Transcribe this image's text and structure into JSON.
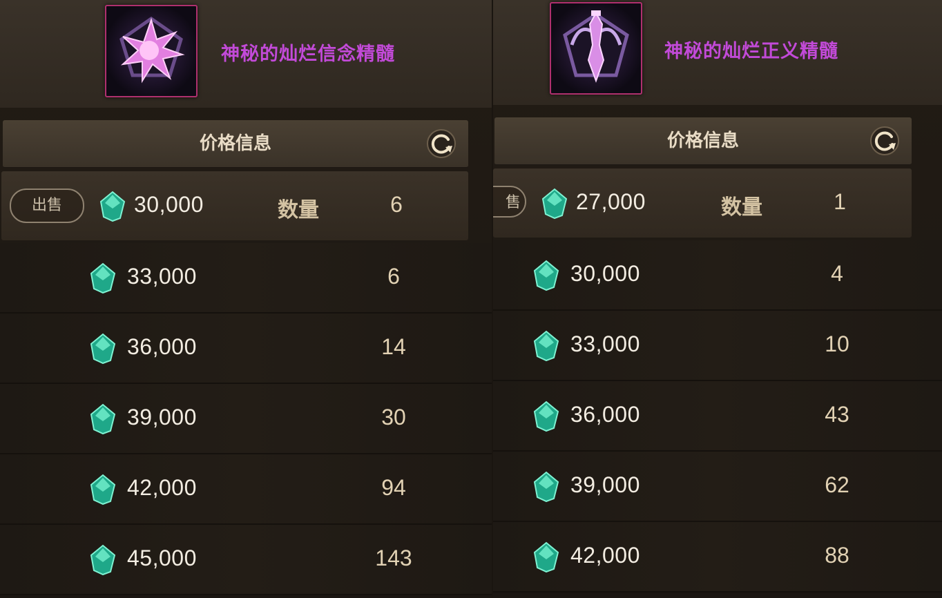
{
  "panels": [
    {
      "item_name": "神秘的灿烂信念精髓",
      "item_icon": "star-essence-icon",
      "price_info_label": "价格信息",
      "sell_button_label": "出售",
      "quantity_label": "数量",
      "rows": [
        {
          "price": "30,000",
          "qty": "6"
        },
        {
          "price": "33,000",
          "qty": "6"
        },
        {
          "price": "36,000",
          "qty": "14"
        },
        {
          "price": "39,000",
          "qty": "30"
        },
        {
          "price": "42,000",
          "qty": "94"
        },
        {
          "price": "45,000",
          "qty": "143"
        }
      ]
    },
    {
      "item_name": "神秘的灿烂正义精髓",
      "item_icon": "sword-essence-icon",
      "price_info_label": "价格信息",
      "sell_button_label": "售",
      "quantity_label": "数量",
      "rows": [
        {
          "price": "27,000",
          "qty": "1"
        },
        {
          "price": "30,000",
          "qty": "4"
        },
        {
          "price": "33,000",
          "qty": "10"
        },
        {
          "price": "36,000",
          "qty": "43"
        },
        {
          "price": "39,000",
          "qty": "62"
        },
        {
          "price": "42,000",
          "qty": "88"
        }
      ]
    }
  ],
  "colors": {
    "item_name": "#c24ad8",
    "icon_border": "#b0306e",
    "gem": "#2fc9a0",
    "price_text": "#f3ede2",
    "qty_text": "#e2d2b4"
  }
}
